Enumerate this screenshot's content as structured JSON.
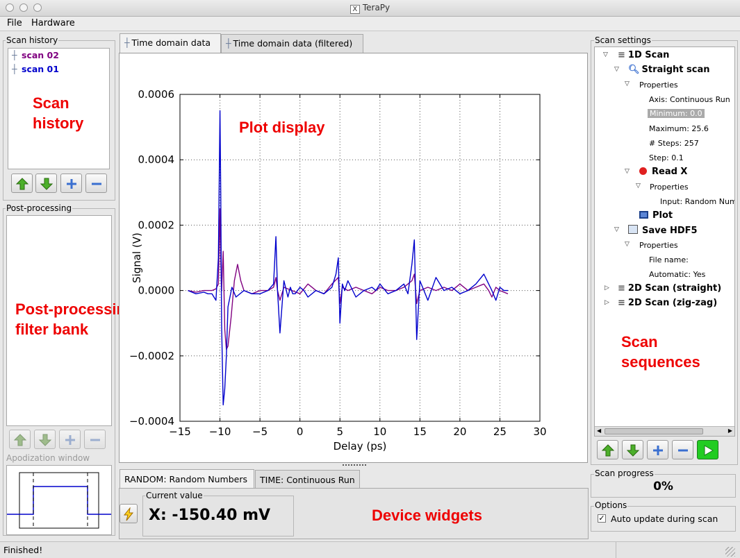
{
  "window": {
    "title": "TeraPy",
    "x_logo": "X"
  },
  "menu": [
    "File",
    "Hardware"
  ],
  "scan_history": {
    "title": "Scan history",
    "items": [
      {
        "label": "scan 02",
        "color": "#800080"
      },
      {
        "label": "scan 01",
        "color": "#0000cc"
      }
    ]
  },
  "post_processing": {
    "title": "Post-processing"
  },
  "apodization": {
    "title": "Apodization window"
  },
  "plot_tabs": [
    "Time domain data",
    "Time domain data (filtered)"
  ],
  "chart_data": {
    "type": "line",
    "xlabel": "Delay (ps)",
    "ylabel": "Signal (V)",
    "xlim": [
      -15,
      30
    ],
    "ylim": [
      -0.0004,
      0.0006
    ],
    "xticks": [
      -15,
      -10,
      -5,
      0,
      5,
      10,
      15,
      20,
      25,
      30
    ],
    "yticks": [
      {
        "v": -0.0004,
        "label": "−0.0004"
      },
      {
        "v": -0.0002,
        "label": "−0.0002"
      },
      {
        "v": 0,
        "label": "0.0000"
      },
      {
        "v": 0.0002,
        "label": "0.0002"
      },
      {
        "v": 0.0004,
        "label": "0.0004"
      },
      {
        "v": 0.0006,
        "label": "0.0006"
      }
    ],
    "grid": true,
    "series": [
      {
        "color": "#0000cc",
        "x": [
          -14.0,
          -13.0,
          -12.0,
          -11.5,
          -11.0,
          -10.5,
          -10.2,
          -10.0,
          -9.9,
          -9.8,
          -9.6,
          -9.4,
          -9.2,
          -9.0,
          -8.5,
          -8.0,
          -7.0,
          -6.0,
          -5.0,
          -4.0,
          -3.3,
          -3.0,
          -2.8,
          -2.5,
          -2.0,
          -1.5,
          -1.2,
          -0.9,
          -0.6,
          -0.3,
          0.0,
          0.5,
          1.0,
          2.0,
          3.0,
          4.0,
          4.5,
          4.8,
          5.0,
          5.3,
          5.6,
          6.0,
          7.0,
          8.0,
          9.0,
          9.5,
          10.0,
          11.0,
          12.0,
          13.0,
          13.5,
          14.0,
          14.3,
          14.6,
          15.0,
          15.5,
          16.0,
          17.0,
          18.0,
          19.0,
          20.0,
          21.0,
          22.0,
          23.0,
          23.6,
          24.0,
          24.5,
          25.0,
          25.5,
          26.0
        ],
        "y": [
          0.0,
          -1e-05,
          -5e-06,
          -1e-05,
          -1e-05,
          -3e-05,
          0.0001,
          0.00055,
          0.0003,
          -0.0001,
          -0.00035,
          -0.0003,
          -0.0002,
          -5e-05,
          1e-05,
          -2e-05,
          0.0,
          -1e-05,
          -1e-05,
          0.0,
          2e-05,
          0.000165,
          0.0,
          -0.00013,
          3e-05,
          -2e-05,
          1e-05,
          -1e-05,
          -1e-05,
          0.0,
          1e-05,
          0.0,
          -2e-05,
          0.0,
          -1e-05,
          1e-05,
          5e-05,
          0.0001,
          -0.0001,
          2e-05,
          0.0,
          3e-05,
          -2e-05,
          0.0,
          1e-05,
          0.0,
          2e-05,
          -1e-05,
          0.0,
          2e-05,
          -1e-05,
          8e-05,
          0.000155,
          -0.00015,
          3e-05,
          0.0,
          -3e-05,
          4e-05,
          0.0,
          1e-05,
          -1e-05,
          0.0,
          2e-05,
          5e-05,
          2e-05,
          0.0,
          -3e-05,
          1e-05,
          0.0,
          0.0
        ]
      },
      {
        "color": "#800080",
        "x": [
          -14.0,
          -13.0,
          -12.0,
          -11.0,
          -10.5,
          -10.2,
          -10.0,
          -9.9,
          -9.8,
          -9.6,
          -9.4,
          -9.2,
          -9.0,
          -8.6,
          -8.2,
          -7.8,
          -7.4,
          -7.0,
          -6.0,
          -5.0,
          -4.0,
          -3.3,
          -3.0,
          -2.8,
          -2.5,
          -2.0,
          -1.0,
          0.0,
          1.0,
          2.0,
          3.0,
          4.0,
          4.8,
          5.0,
          5.3,
          6.0,
          7.0,
          8.0,
          9.0,
          10.0,
          11.0,
          12.0,
          13.0,
          14.0,
          14.3,
          14.6,
          15.0,
          16.0,
          17.0,
          18.0,
          19.0,
          20.0,
          21.0,
          22.0,
          23.0,
          23.6,
          24.0,
          24.5,
          25.0,
          26.0
        ],
        "y": [
          0.0,
          -5e-06,
          0.0,
          0.0,
          5e-06,
          2e-05,
          0.00025,
          0.0001,
          0.0,
          0.00012,
          -0.00012,
          -0.00018,
          -0.00017,
          -8e-05,
          3e-05,
          8e-05,
          3e-05,
          0.0,
          -1e-05,
          0.0,
          0.0,
          1e-05,
          4e-05,
          0.0,
          -3e-05,
          1e-05,
          0.0,
          -1e-05,
          2e-05,
          0.0,
          -1e-05,
          2e-05,
          4e-05,
          -4e-05,
          1e-05,
          0.0,
          1e-05,
          0.0,
          -1e-05,
          1e-05,
          0.0,
          0.0,
          1e-05,
          3e-05,
          5e-05,
          -4e-05,
          0.0,
          1e-05,
          0.0,
          1e-05,
          0.0,
          2e-05,
          0.0,
          1e-05,
          2e-05,
          0.0,
          -2e-05,
          1e-05,
          0.0,
          -1e-05
        ]
      }
    ]
  },
  "device_tabs": [
    "RANDOM: Random Numbers",
    "TIME: Continuous Run"
  ],
  "current_value": {
    "title": "Current value",
    "value": "X: -150.40 mV"
  },
  "scan_settings": {
    "title": "Scan settings",
    "rows": [
      {
        "text": "1D Scan"
      },
      {
        "text": "Straight scan"
      },
      {
        "text": "Properties"
      },
      {
        "text": "Axis: Continuous Run"
      },
      {
        "text": "Minimum: 0.0"
      },
      {
        "text": "Maximum: 25.6"
      },
      {
        "text": "# Steps: 257"
      },
      {
        "text": "Step: 0.1"
      },
      {
        "text": "Read X"
      },
      {
        "text": "Properties"
      },
      {
        "text": "Input: Random Num"
      },
      {
        "text": "Plot"
      },
      {
        "text": "Save HDF5"
      },
      {
        "text": "Properties"
      },
      {
        "text": "File name:"
      },
      {
        "text": "Automatic: Yes"
      },
      {
        "text": "2D Scan (straight)"
      },
      {
        "text": "2D Scan (zig-zag)"
      }
    ]
  },
  "scan_progress": {
    "title": "Scan progress",
    "value": "0%"
  },
  "options": {
    "title": "Options",
    "auto_update_label": "Auto update during scan",
    "auto_update": true
  },
  "status": "Finished!",
  "annotations": {
    "scan_history": [
      "Scan",
      "history"
    ],
    "plot_display": "Plot display",
    "post_processing": [
      "Post-processing",
      "filter bank"
    ],
    "scan_sequences": [
      "Scan",
      "sequences"
    ],
    "device_widgets": "Device widgets"
  },
  "colors": {
    "red_annotation": "#ee0000",
    "scan_02": "#800080",
    "scan_01": "#0000cc",
    "start_button": "#22cc22"
  }
}
